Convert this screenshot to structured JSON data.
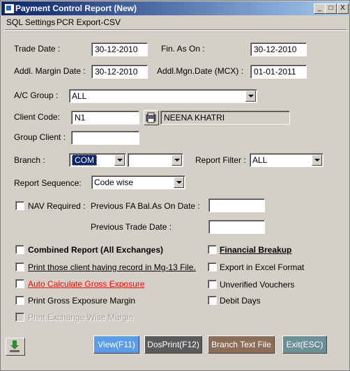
{
  "window": {
    "title": "Payment Control Report (New)"
  },
  "title_buttons": {
    "minimize": "_",
    "maximize": "□",
    "close": "X"
  },
  "menu": {
    "items": [
      "SQL Settings",
      "PCR Export-CSV"
    ]
  },
  "fields": {
    "trade_date": {
      "label": "Trade Date :",
      "value": "30-12-2010"
    },
    "fin_as_on": {
      "label": "Fin. As On :",
      "value": "30-12-2010"
    },
    "addl_margin_date": {
      "label": "Addl. Margin Date :",
      "value": "30-12-2010"
    },
    "addl_mgn_date_mcx": {
      "label": "Addl.Mgn.Date (MCX) :",
      "value": "01-01-2011"
    },
    "ac_group": {
      "label": "A/C Group :",
      "value": "ALL"
    },
    "client_code": {
      "label": "Client Code:",
      "value": "N1",
      "name": "NEENA KHATRI"
    },
    "group_client": {
      "label": "Group Client :",
      "value": ""
    },
    "branch": {
      "label": "Branch :",
      "value": "COM",
      "value2": ""
    },
    "report_filter": {
      "label": "Report Filter :",
      "value": "ALL"
    },
    "report_sequence": {
      "label": "Report Sequence:",
      "value": "Code wise"
    },
    "nav_required": {
      "label": "NAV Required :",
      "checked": false
    },
    "prev_fa_bal": {
      "label": "Previous FA Bal.As On Date :",
      "value": ""
    },
    "prev_trade_date": {
      "label": "Previous Trade Date :",
      "value": ""
    }
  },
  "options": {
    "combined_report": {
      "label": "Combined Report (All Exchanges)",
      "checked": false
    },
    "print_mg13": {
      "label": "Print those client having record in Mg-13 File.",
      "checked": false
    },
    "auto_calc_gross": {
      "label": "Auto Calculate Gross Exposure",
      "checked": false,
      "color": "#ff0000"
    },
    "print_gross_margin": {
      "label": "Print Gross Exposure Margin",
      "checked": false
    },
    "print_exch_wise": {
      "label": "Print Exchange Wise Margin",
      "checked": false,
      "disabled": true
    },
    "financial_breakup": {
      "label": "Financial Breakup",
      "checked": false
    },
    "export_excel": {
      "label": "Export in Excel Format",
      "checked": false
    },
    "unverified_vouchers": {
      "label": "Unverified Vouchers",
      "checked": false
    },
    "debit_days": {
      "label": "Debit Days",
      "checked": false
    }
  },
  "buttons": {
    "view": {
      "label": "View(F11)",
      "color": "#5b9be8"
    },
    "dosprint": {
      "label": "DosPrint(F12)",
      "color": "#5a5a5a"
    },
    "branch_text": {
      "label": "Branch Text File",
      "color": "#8c6e58"
    },
    "exit": {
      "label": "Exit(ESC)",
      "color": "#6a8f94"
    }
  }
}
